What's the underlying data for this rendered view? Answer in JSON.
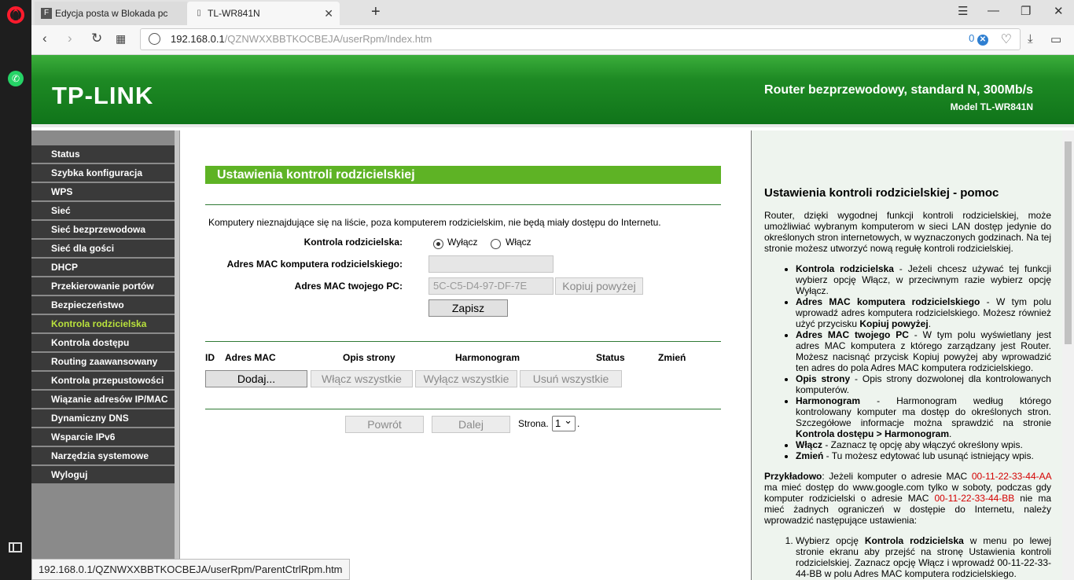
{
  "browser": {
    "tabs": [
      {
        "favicon": "F",
        "title": "Edycja posta w Blokada pc"
      },
      {
        "favicon": "▯",
        "title": "TL-WR841N"
      }
    ],
    "url_host": "192.168.0.1",
    "url_path": "/QZNWXXBBTKOCBEJA/userRpm/Index.htm",
    "adblock_count": "0",
    "status_url": "192.168.0.1/QZNWXXBBTKOCBEJA/userRpm/ParentCtrlRpm.htm"
  },
  "header": {
    "logo": "TP-LINK",
    "title": "Router bezprzewodowy, standard N, 300Mb/s",
    "model": "Model TL-WR841N"
  },
  "menu": [
    "Status",
    "Szybka konfiguracja",
    "WPS",
    "Sieć",
    "Sieć bezprzewodowa",
    "Sieć dla gości",
    "DHCP",
    "Przekierowanie portów",
    "Bezpieczeństwo",
    "Kontrola rodzicielska",
    "Kontrola dostępu",
    "Routing zaawansowany",
    "Kontrola przepustowości",
    "Wiązanie adresów IP/MAC",
    "Dynamiczny DNS",
    "Wsparcie IPv6",
    "Narzędzia systemowe",
    "Wyloguj"
  ],
  "main": {
    "title": "Ustawienia kontroli rodzicielskiej",
    "note": "Komputery nieznajdujące się na liście, poza komputerem rodzicielskim, nie będą miały dostępu do Internetu.",
    "parental_label": "Kontrola rodzicielska:",
    "off_label": "Wyłącz",
    "on_label": "Włącz",
    "parent_mac_label": "Adres MAC komputera rodzicielskiego:",
    "parent_mac_value": "",
    "your_mac_label": "Adres MAC twojego PC:",
    "your_mac_value": "5C-C5-D4-97-DF-7E",
    "copy_button": "Kopiuj powyżej",
    "save_button": "Zapisz",
    "table_headers": [
      "ID",
      "Adres MAC",
      "Opis strony",
      "Harmonogram",
      "Status",
      "Zmień"
    ],
    "add_button": "Dodaj...",
    "enable_all": "Włącz wszystkie",
    "disable_all": "Wyłącz wszystkie",
    "delete_all": "Usuń wszystkie",
    "prev_button": "Powrót",
    "next_button": "Dalej",
    "page_label": "Strona.",
    "page_value": "1",
    "page_dot": "."
  },
  "help": {
    "title": "Ustawienia kontroli rodzicielskiej - pomoc",
    "intro": "Router, dzięki wygodnej funkcji kontroli rodzicielskiej, może umożliwiać wybranym komputerom w sieci LAN dostęp jedynie do określonych stron internetowych, w wyznaczonych godzinach. Na tej stronie możesz utworzyć nową regułę kontroli rodzicielskiej.",
    "items": [
      {
        "term": "Kontrola rodzicielska",
        "text": " - Jeżeli chcesz używać tej funkcji wybierz opcję Włącz, w przeciwnym razie wybierz opcję Wyłącz."
      },
      {
        "term": "Adres MAC komputera rodzicielskiego",
        "text": " - W tym polu wprowadź adres komputera rodzicielskiego. Możesz również użyć przycisku ",
        "term2": "Kopiuj powyżej",
        "text2": "."
      },
      {
        "term": "Adres MAC twojego PC",
        "text": " - W tym polu wyświetlany jest adres MAC komputera z którego zarządzany jest Router. Możesz nacisnąć przycisk Kopiuj powyżej aby wprowadzić ten adres do pola Adres MAC komputera rodzicielskiego."
      },
      {
        "term": "Opis strony",
        "text": " - Opis strony dozwolonej dla kontrolowanych komputerów."
      },
      {
        "term": "Harmonogram",
        "text": " - Harmonogram według którego kontrolowany komputer ma dostęp do określonych stron. Szczegółowe informacje można sprawdzić na stronie ",
        "term2": "Kontrola dostępu > Harmonogram",
        "text2": "."
      },
      {
        "term": "Włącz",
        "text": " - Zaznacz tę opcję aby włączyć określony wpis."
      },
      {
        "term": "Zmień",
        "text": " - Tu możesz edytować lub usunąć istniejący wpis."
      }
    ],
    "example_term": "Przykładowo",
    "example_1": ": Jeżeli komputer o adresie MAC ",
    "example_mac1": "00-11-22-33-44-AA",
    "example_2": " ma mieć dostęp do www.google.com tylko w soboty, podczas gdy komputer rodzicielski o adresie MAC ",
    "example_mac2": "00-11-22-33-44-BB",
    "example_3": " nie ma mieć żadnych ograniczeń w dostępie do Internetu, należy wprowadzić następujące ustawienia:",
    "step1_a": "Wybierz opcję ",
    "step1_term": "Kontrola rodzicielska",
    "step1_b": " w menu po lewej stronie ekranu aby przejść na stronę Ustawienia kontroli rodzicielskiej. Zaznacz opcję Włącz i wprowadź 00-11-22-33-44-BB w polu Adres MAC komputera rodzicielskiego."
  }
}
